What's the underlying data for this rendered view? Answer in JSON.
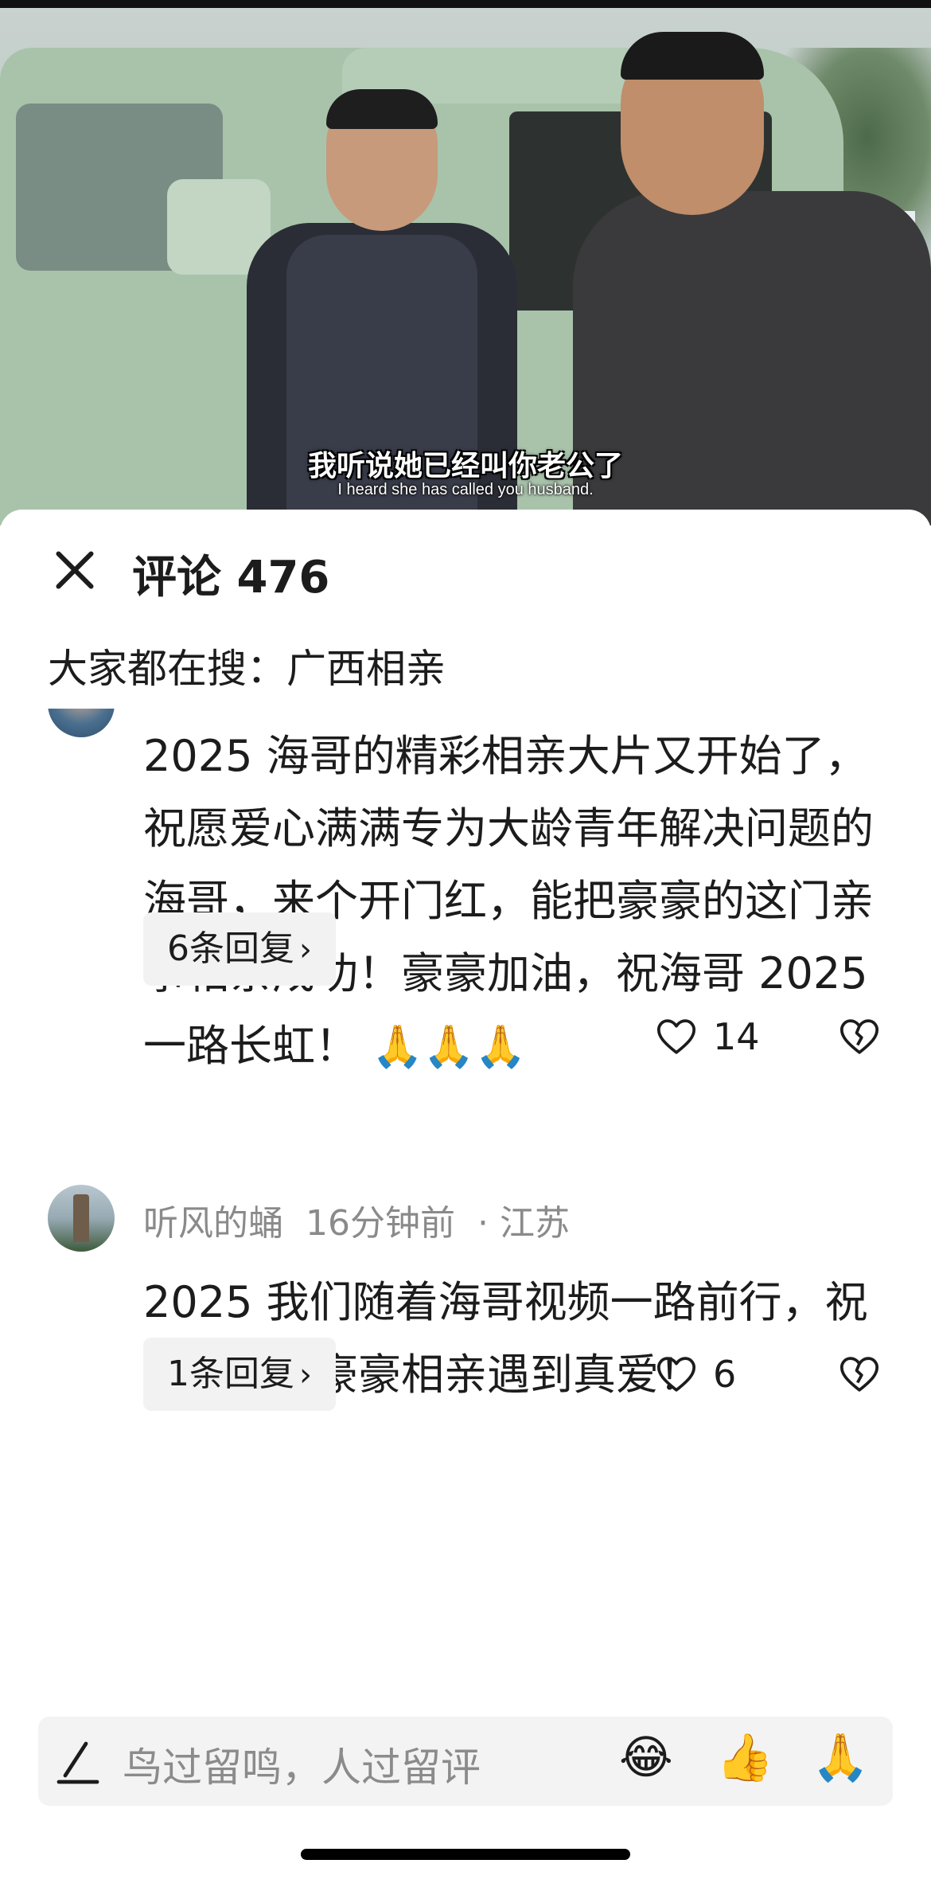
{
  "video": {
    "subtitle_cn": "我听说她已经叫你老公了",
    "subtitle_en": "I heard she has called you husband."
  },
  "header": {
    "title": "评论 476"
  },
  "search_suggestion": "大家都在搜：广西相亲",
  "comments": [
    {
      "text": "2025 海哥的精彩相亲大片又开始了，祝愿爱心满满专为大龄青年解决问题的海哥，来个开门红，能把豪豪的这门亲事相亲成功！豪豪加油，祝海哥 2025 一路长虹！",
      "emoji": "🙏🙏🙏",
      "replies_label": "6条回复",
      "likes": "14"
    },
    {
      "author": "听风的蛹",
      "time": "16分钟前",
      "location": "· 江苏",
      "text": "2025 我们随着海哥视频一路前行，祝海哥帮助豪豪相亲遇到真爱！",
      "replies_label": "1条回复",
      "likes": "6"
    }
  ],
  "input": {
    "placeholder": "鸟过留鸣，人过留评",
    "quick_emojis": [
      "😂",
      "👍",
      "🙏"
    ]
  },
  "icons": {
    "close": "close-icon",
    "heart": "heart-icon",
    "broken_heart": "broken-heart-icon",
    "pen": "pen-icon",
    "chevron": "chevron-right-icon"
  }
}
